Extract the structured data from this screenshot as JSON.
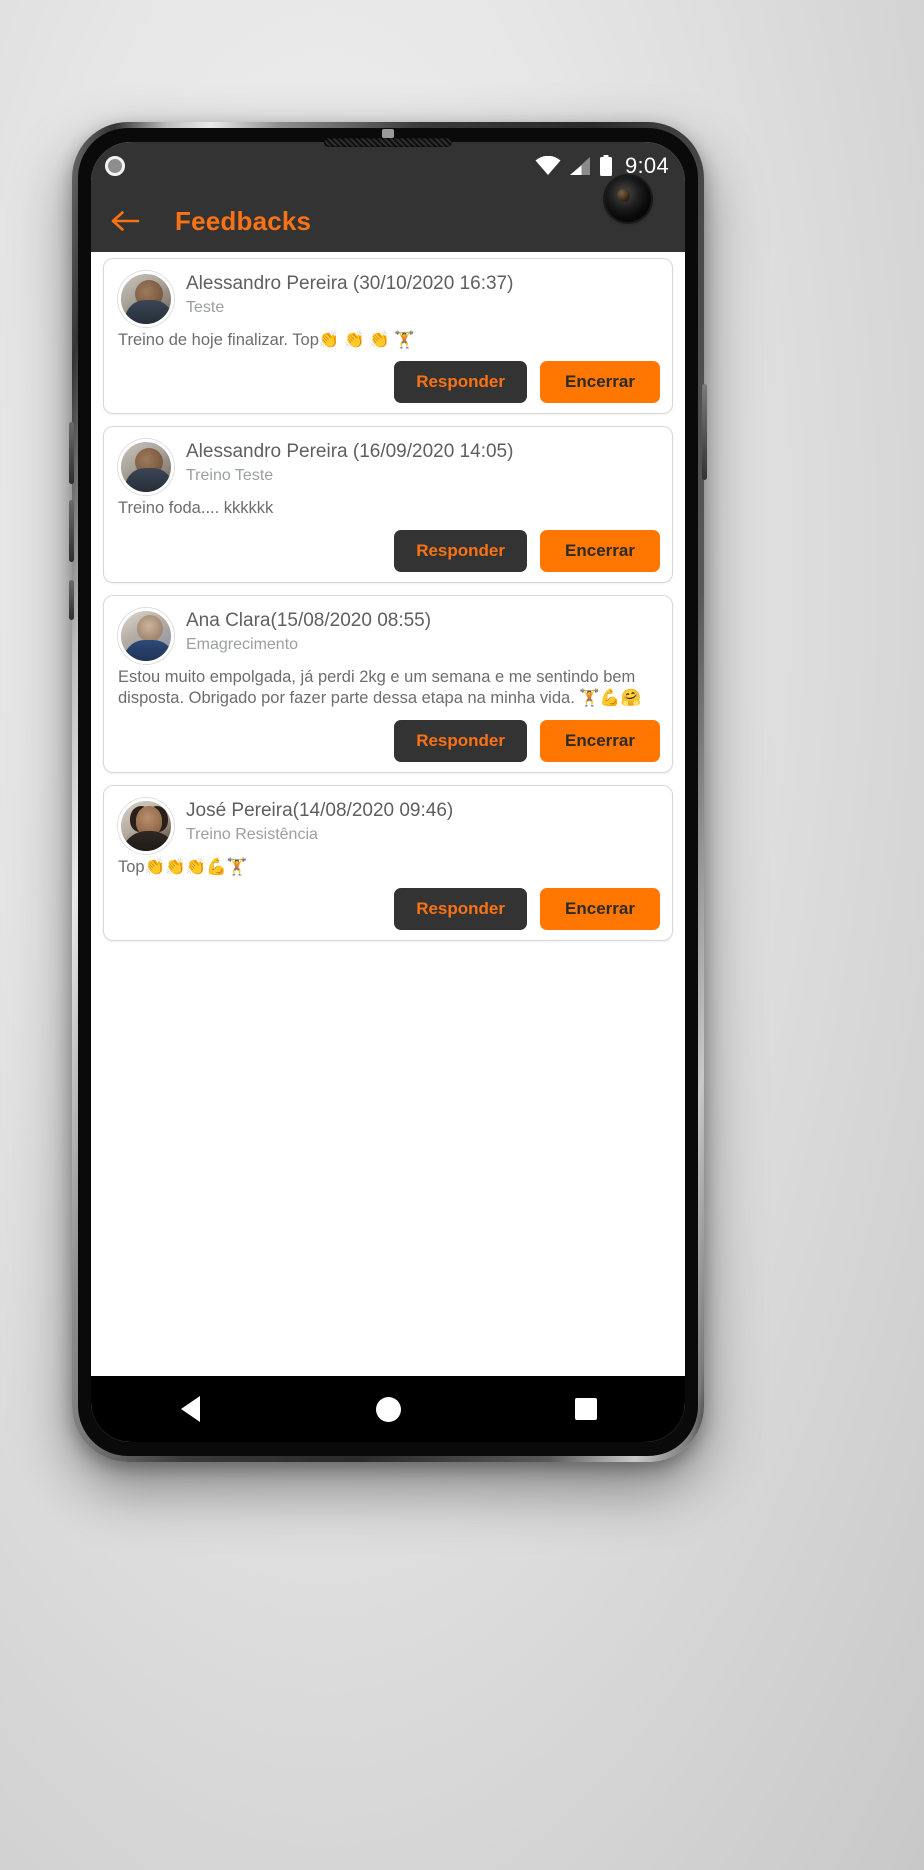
{
  "status_bar": {
    "time": "9:04",
    "icons": [
      "wifi-icon",
      "cellular-signal-icon",
      "battery-icon"
    ],
    "left_dot": "notification-dot-icon"
  },
  "app_bar": {
    "back_icon": "arrow-left-icon",
    "title": "Feedbacks",
    "background_color": "#333333",
    "accent_color": "#f97316"
  },
  "buttons": {
    "reply_label": "Responder",
    "close_label": "Encerrar",
    "reply_bg": "#333333",
    "reply_fg": "#f97316",
    "close_bg": "#ff7700",
    "close_fg": "#2b2b2b"
  },
  "feedbacks": [
    {
      "author": "Alessandro Pereira (30/10/2020 16:37)",
      "subject": "Teste",
      "message": "Treino de hoje finalizar. Top👏 👏 👏 🏋️",
      "avatar": "avatar-alessandro"
    },
    {
      "author": "Alessandro Pereira (16/09/2020 14:05)",
      "subject": "Treino Teste",
      "message": "Treino foda.... kkkkkk",
      "avatar": "avatar-alessandro"
    },
    {
      "author": "Ana Clara(15/08/2020 08:55)",
      "subject": "Emagrecimento",
      "message": "Estou muito empolgada, já perdi 2kg e um semana e me sentindo bem disposta. Obrigado por fazer parte dessa etapa na minha vida. 🏋️💪🤗",
      "avatar": "avatar-ana"
    },
    {
      "author": "José Pereira(14/08/2020 09:46)",
      "subject": "Treino Resistência",
      "message": "Top👏👏👏💪🏋️",
      "avatar": "avatar-jose"
    }
  ],
  "nav_bar": {
    "back": "back-triangle-icon",
    "home": "home-circle-icon",
    "recents": "recents-square-icon"
  }
}
